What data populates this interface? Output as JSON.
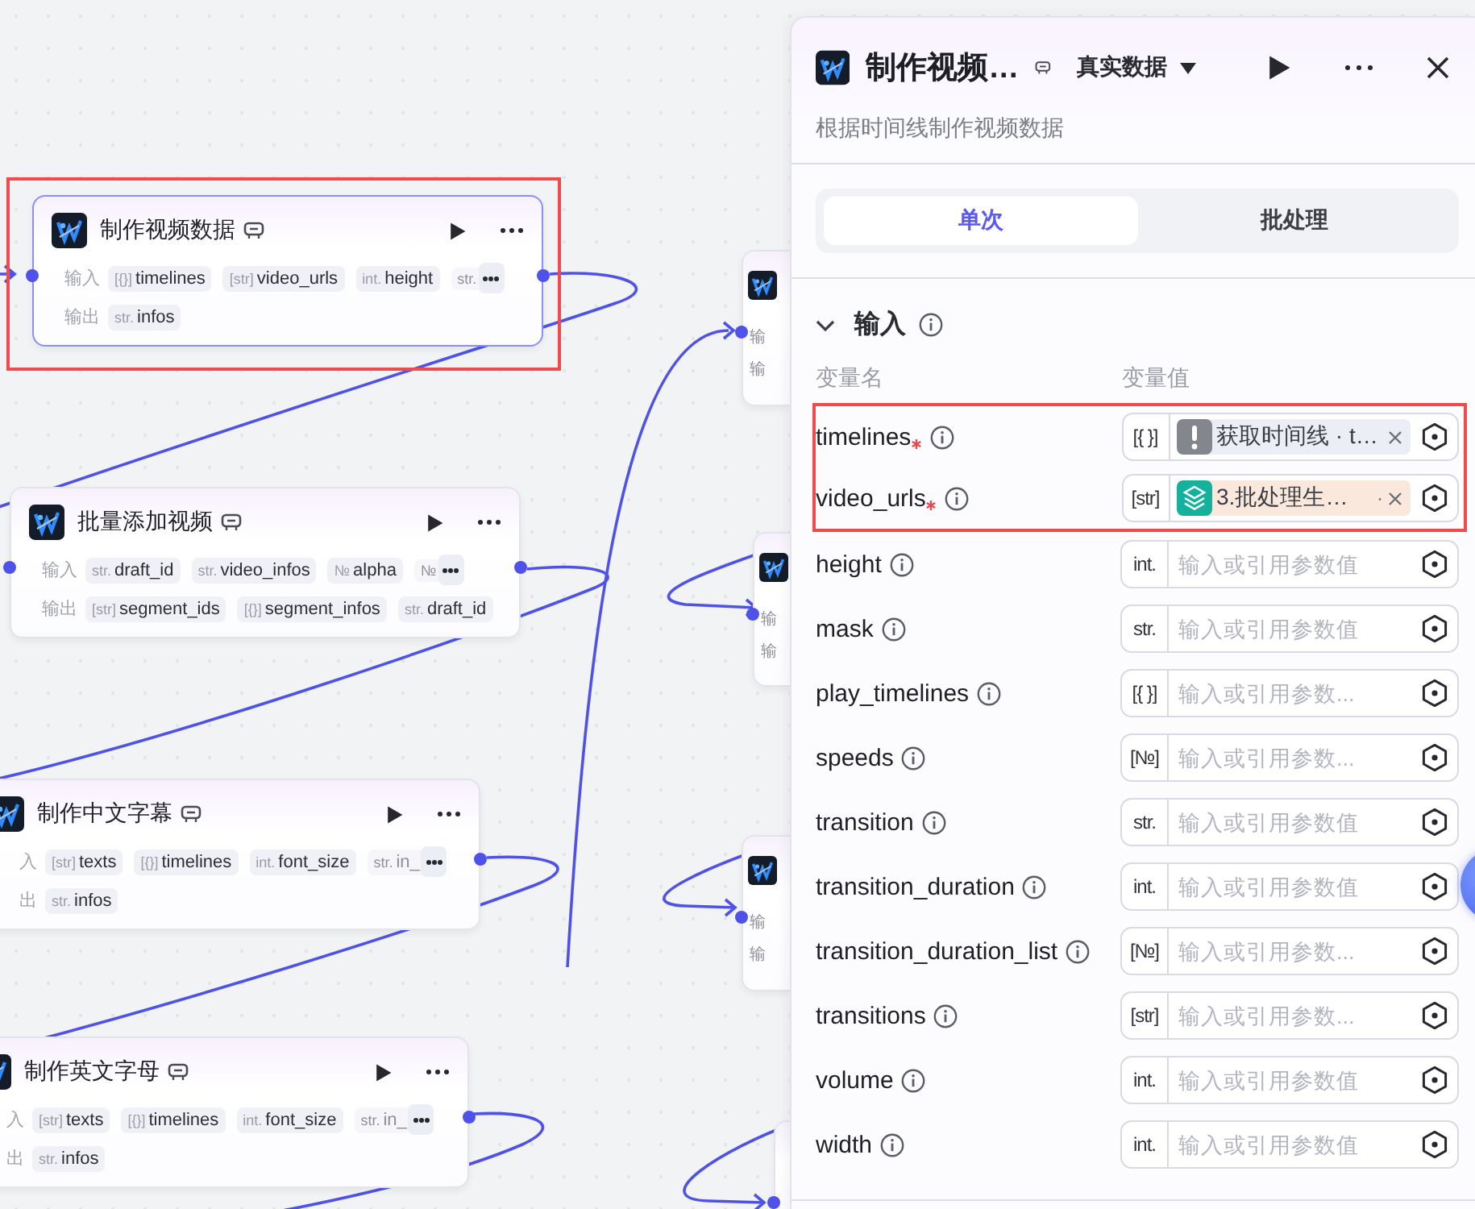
{
  "canvas": {
    "nodes": [
      {
        "title": "制作视频数据",
        "selected": true,
        "highlighted": true,
        "inputs_label": "输入",
        "outputs_label": "输出",
        "inputs": [
          {
            "type": "[{}]",
            "name": "timelines",
            "faded": false
          },
          {
            "type": "[str]",
            "name": "video_urls",
            "faded": false
          },
          {
            "type": "int.",
            "name": "height",
            "faded": false
          },
          {
            "type": "str.",
            "faded": true
          }
        ],
        "outputs": [
          {
            "type": "str.",
            "name": "infos",
            "faded": false
          }
        ]
      },
      {
        "title": "批量添加视频",
        "selected": false,
        "highlighted": false,
        "inputs_label": "输入",
        "outputs_label": "输出",
        "inputs": [
          {
            "type": "str.",
            "name": "draft_id",
            "faded": false
          },
          {
            "type": "str.",
            "name": "video_infos",
            "faded": false
          },
          {
            "type": "№",
            "name": "alpha",
            "faded": false
          },
          {
            "type": "№",
            "faded": true
          }
        ],
        "outputs": [
          {
            "type": "[str]",
            "name": "segment_ids",
            "faded": false
          },
          {
            "type": "[{}]",
            "name": "segment_infos",
            "faded": false
          },
          {
            "type": "str.",
            "name": "draft_id",
            "faded": false
          }
        ]
      },
      {
        "title": "制作中文字幕",
        "selected": false,
        "highlighted": false,
        "inputs_label": "入",
        "outputs_label": "出",
        "inputs": [
          {
            "type": "[str]",
            "name": "texts",
            "faded": false
          },
          {
            "type": "[{}]",
            "name": "timelines",
            "faded": false
          },
          {
            "type": "int.",
            "name": "font_size",
            "faded": false
          },
          {
            "type": "str.",
            "name": "in_",
            "faded": true
          }
        ],
        "outputs": [
          {
            "type": "str.",
            "name": "infos",
            "faded": false
          }
        ]
      },
      {
        "title": "制作英文字母",
        "selected": false,
        "highlighted": false,
        "inputs_label": "入",
        "outputs_label": "出",
        "inputs": [
          {
            "type": "[str]",
            "name": "texts",
            "faded": false
          },
          {
            "type": "[{}]",
            "name": "timelines",
            "faded": false
          },
          {
            "type": "int.",
            "name": "font_size",
            "faded": false
          },
          {
            "type": "str.",
            "name": "in_",
            "faded": true
          }
        ],
        "outputs": [
          {
            "type": "str.",
            "name": "infos",
            "faded": false
          }
        ]
      }
    ],
    "hidden_nodes": [
      {
        "icon": true,
        "inputs_label": "输",
        "outputs_label": "输"
      },
      {
        "icon": true,
        "inputs_label": "输",
        "outputs_label": "输"
      },
      {
        "icon": true,
        "inputs_label": "输",
        "outputs_label": "输"
      },
      {
        "icon": false
      }
    ]
  },
  "panel": {
    "title": "制作视频…",
    "mode": "真实数据",
    "description": "根据时间线制作视频数据",
    "tabs": [
      {
        "label": "单次",
        "selected": true
      },
      {
        "label": "批处理",
        "selected": false
      }
    ],
    "section": {
      "title": "输入",
      "expanded": true,
      "name_header": "变量名",
      "value_header": "变量值",
      "params": [
        {
          "name": "timelines",
          "required": true,
          "highlighted": true,
          "type": "[{ }]",
          "reference": {
            "kind": "warning",
            "label": "获取时间线 · t…"
          }
        },
        {
          "name": "video_urls",
          "required": true,
          "highlighted": true,
          "type": "[str]",
          "reference": {
            "kind": "layers",
            "label": "3.批处理生…",
            "suffix": "·"
          }
        },
        {
          "name": "height",
          "required": false,
          "highlighted": false,
          "type": "int.",
          "placeholder": "输入或引用参数值"
        },
        {
          "name": "mask",
          "required": false,
          "highlighted": false,
          "type": "str.",
          "placeholder": "输入或引用参数值"
        },
        {
          "name": "play_timelines",
          "required": false,
          "highlighted": false,
          "type": "[{ }]",
          "placeholder": "输入或引用参数..."
        },
        {
          "name": "speeds",
          "required": false,
          "highlighted": false,
          "type": "[№]",
          "placeholder": "输入或引用参数..."
        },
        {
          "name": "transition",
          "required": false,
          "highlighted": false,
          "type": "str.",
          "placeholder": "输入或引用参数值"
        },
        {
          "name": "transition_duration",
          "required": false,
          "highlighted": false,
          "type": "int.",
          "placeholder": "输入或引用参数值"
        },
        {
          "name": "transition_duration_list",
          "required": false,
          "highlighted": false,
          "type": "[№]",
          "placeholder": "输入或引用参数..."
        },
        {
          "name": "transitions",
          "required": false,
          "highlighted": false,
          "type": "[str]",
          "placeholder": "输入或引用参数..."
        },
        {
          "name": "volume",
          "required": false,
          "highlighted": false,
          "type": "int.",
          "placeholder": "输入或引用参数值"
        },
        {
          "name": "width",
          "required": false,
          "highlighted": false,
          "type": "int.",
          "placeholder": "输入或引用参数值"
        }
      ]
    }
  }
}
